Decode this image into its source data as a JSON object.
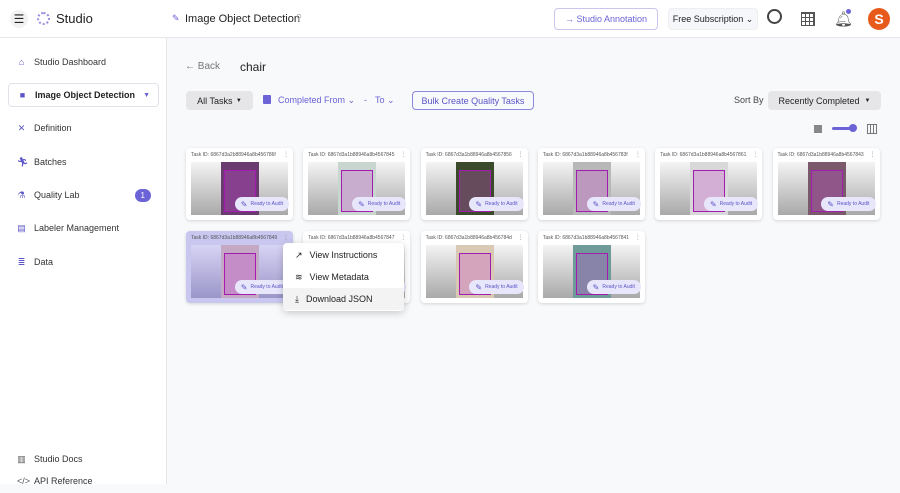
{
  "header": {
    "app_name": "Studio",
    "project_title": "Image Object Detection",
    "studio_annotation": "Studio Annotation",
    "subscription": "Free Subscription"
  },
  "sidebar": {
    "items": [
      {
        "label": "Studio Dashboard",
        "icon": "home-icon"
      },
      {
        "label": "Image Object Detection",
        "icon": "folder-icon"
      },
      {
        "label": "Definition",
        "icon": "tools-icon"
      },
      {
        "label": "Batches",
        "icon": "runner-icon"
      },
      {
        "label": "Quality Lab",
        "icon": "flask-icon",
        "badge": "1"
      },
      {
        "label": "Labeler Management",
        "icon": "id-card-icon"
      },
      {
        "label": "Data",
        "icon": "database-icon"
      }
    ],
    "bottom": [
      {
        "label": "Studio Docs"
      },
      {
        "label": "API Reference"
      }
    ]
  },
  "toolbar": {
    "back": "Back",
    "label_name": "chair",
    "all_tasks": "All Tasks",
    "completed_from": "Completed From",
    "dash": "-",
    "to": "To",
    "bulk": "Bulk Create Quality Tasks",
    "sort_by": "Sort By",
    "sort_value": "Recently Completed"
  },
  "zoom_slider_value": 1.0,
  "cards": [
    {
      "id": "Task ID: 6867d3a2b88946a8b456786f",
      "status": "Ready to Audit",
      "photo": "#6a3a70"
    },
    {
      "id": "Task ID: 6867d3a1b88946a8b4567845",
      "status": "Ready to Audit",
      "photo": "#c9d6cf"
    },
    {
      "id": "Task ID: 6867d3a1b88946a8b4567856",
      "status": "Ready to Audit",
      "photo": "#3b4a2a"
    },
    {
      "id": "Task ID: 6867d3a1b88946a8b456783f",
      "status": "Ready to Audit",
      "photo": "#b8b8b8"
    },
    {
      "id": "Task ID: 6867d3a1b88946a8b4567861",
      "status": "Ready to Audit",
      "photo": "#d8d8d8"
    },
    {
      "id": "Task ID: 6867d3a1b88946a8b4567843",
      "status": "Ready to Audit",
      "photo": "#7a5a6a"
    },
    {
      "id": "Task ID: 6867d3a1b88946a8b4567849",
      "status": "Ready to Audit",
      "photo": "#c4a8c4"
    },
    {
      "id": "Task ID: 6867d3a1b88946a8b4567847",
      "status": "Ready to Audit",
      "photo": "#d8d8d8"
    },
    {
      "id": "Task ID: 6867d3a1b88946a8b456784d",
      "status": "Ready to Audit",
      "photo": "#d9c9b4"
    },
    {
      "id": "Task ID: 6867d3a1b88946a8b4567841",
      "status": "Ready to Audit",
      "photo": "#6e9a98"
    }
  ],
  "context_menu": {
    "items": [
      "View Instructions",
      "View Metadata",
      "Download JSON"
    ]
  },
  "colors": {
    "accent": "#6b63d6",
    "brand": "#e85a1b"
  }
}
